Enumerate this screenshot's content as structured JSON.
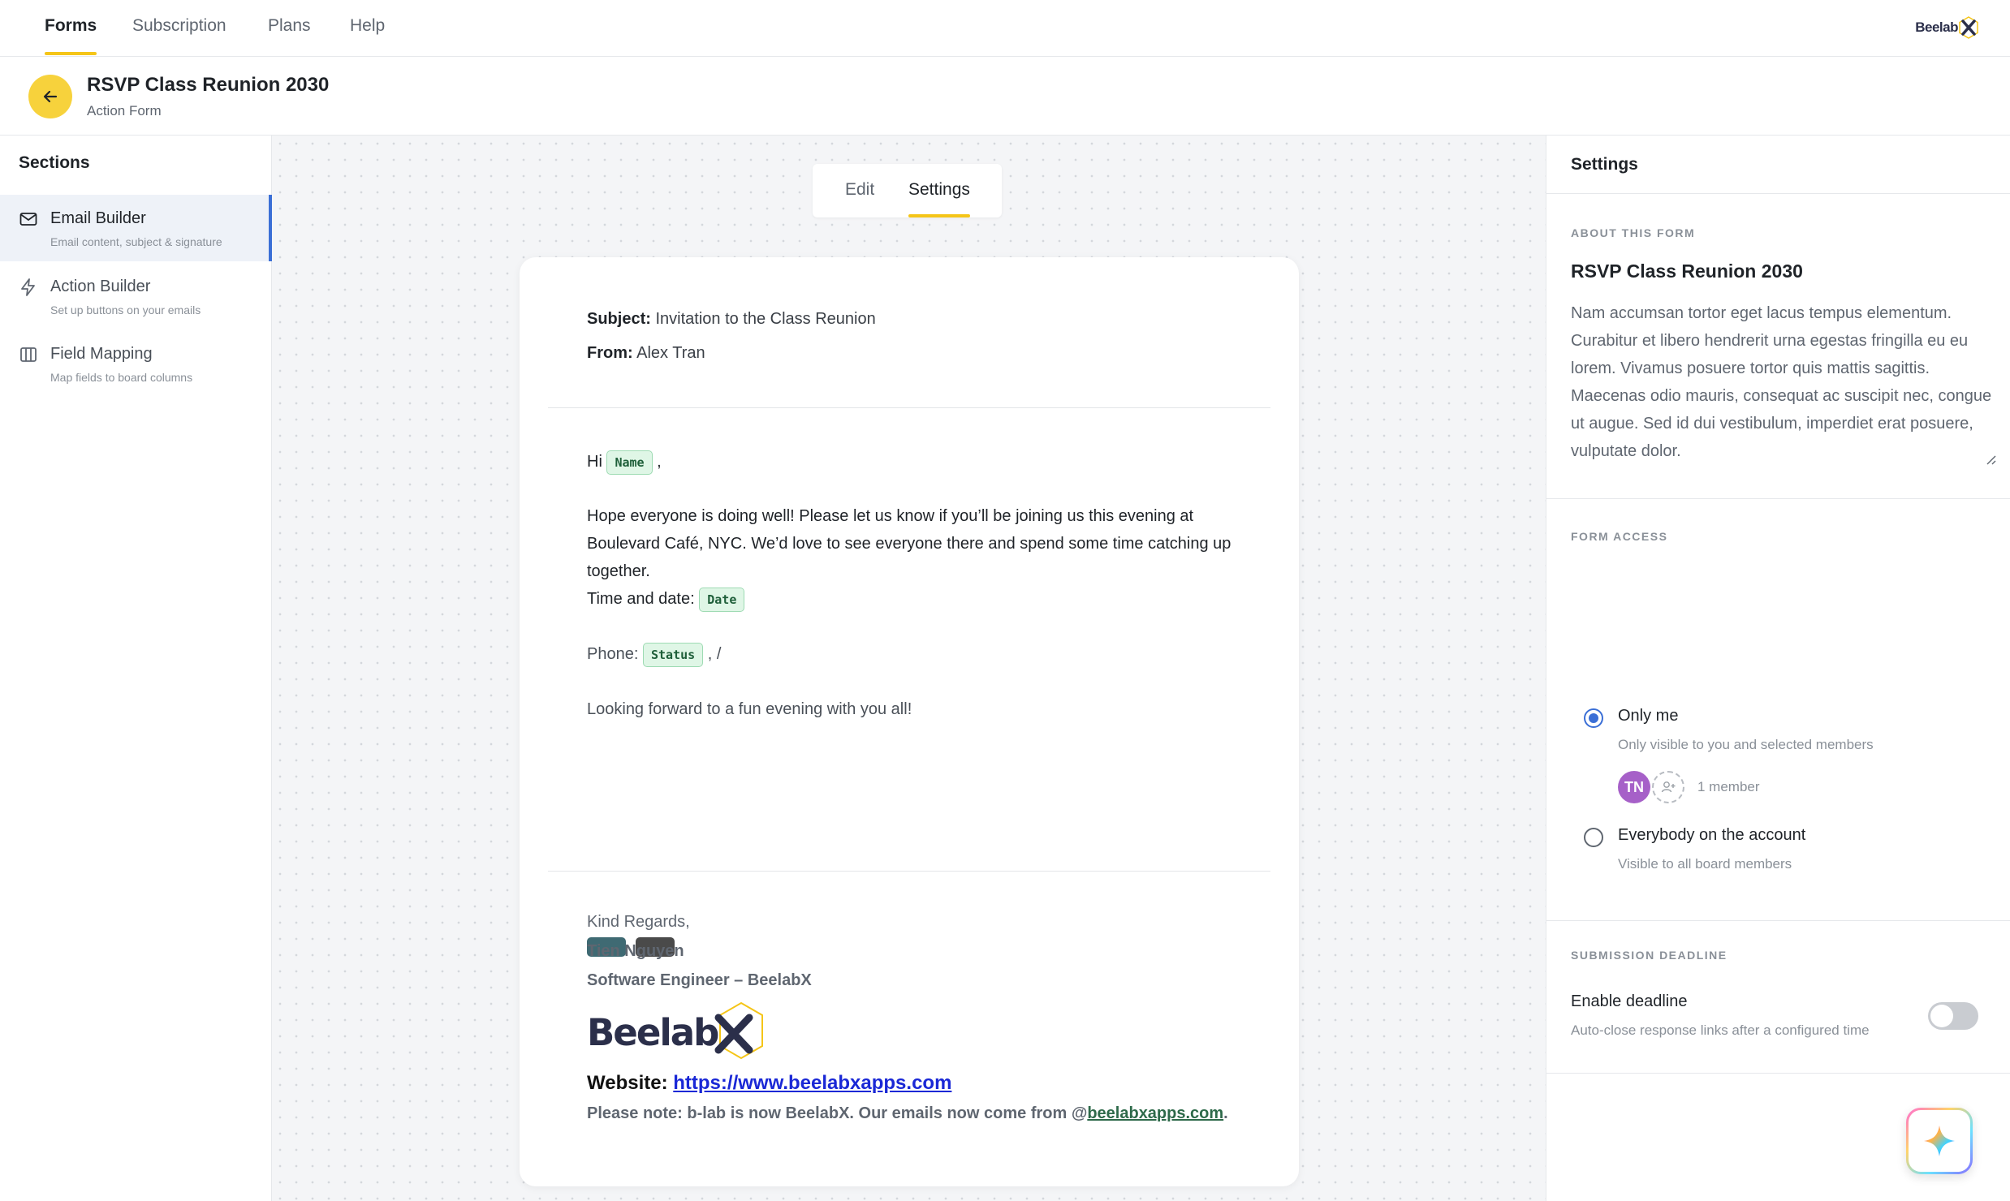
{
  "topnav": {
    "tabs": [
      {
        "label": "Forms",
        "active": true
      },
      {
        "label": "Subscription",
        "active": false
      },
      {
        "label": "Plans",
        "active": false
      },
      {
        "label": "Help",
        "active": false
      }
    ],
    "brand": "Beelab"
  },
  "header": {
    "title": "RSVP Class Reunion 2030",
    "subtitle": "Action Form",
    "back_icon": "arrow-left-icon"
  },
  "sidebar": {
    "heading": "Sections",
    "items": [
      {
        "label": "Email Builder",
        "desc": "Email content, subject & signature",
        "icon": "mail-icon",
        "active": true
      },
      {
        "label": "Action Builder",
        "desc": "Set up buttons on your emails",
        "icon": "bolt-icon",
        "active": false
      },
      {
        "label": "Field Mapping",
        "desc": "Map fields to board columns",
        "icon": "columns-icon",
        "active": false
      }
    ]
  },
  "editor_tabs": {
    "edit": "Edit",
    "settings": "Settings",
    "active": "Settings"
  },
  "email": {
    "subject_label": "Subject:",
    "subject": "Invitation to the Class Reunion",
    "from_label": "From:",
    "from": "Alex Tran",
    "greeting": "Hi",
    "name_tag": "Name",
    "greeting_suffix": ",",
    "paragraph": "Hope everyone is doing well! Please let us know if you’ll be joining us this evening at Boulevard Café, NYC. We’d love to see everyone there and spend some time catching up together.",
    "time_label": "Time and date:",
    "date_tag": "Date",
    "phone_label": "Phone:",
    "status_tag": "Status",
    "phone_suffix": ", /",
    "closing": "Looking forward to a fun evening with you all!",
    "button_colors": [
      "#3f6a73",
      "#4a4a4a"
    ],
    "signature": {
      "regards": "Kind Regards,",
      "name": "Tien Nguyen",
      "role": "Software Engineer – BeelabX",
      "logo_text": "Beelab",
      "website_label": "Website:",
      "website_url": "https://www.beelabxapps.com",
      "note_prefix": "Please note: b-lab is now BeelabX. Our emails now come from @",
      "note_domain": "beelabxapps.com",
      "note_suffix": "."
    }
  },
  "settings": {
    "heading": "Settings",
    "about": {
      "caption": "ABOUT THIS FORM",
      "name": "RSVP Class Reunion 2030",
      "description": "Nam accumsan tortor eget lacus tempus elementum. Curabitur et libero hendrerit urna egestas fringilla eu eu lorem. Vivamus posuere tortor quis mattis sagittis. Maecenas odio mauris, consequat ac suscipit nec, congue ut augue. Sed id dui vestibulum, imperdiet erat posuere, vulputate dolor."
    },
    "access": {
      "caption": "FORM ACCESS",
      "options": [
        {
          "label": "Only me",
          "desc": "Only visible to you and selected members",
          "selected": true
        },
        {
          "label": "Everybody on the account",
          "desc": "Visible to all board members",
          "selected": false
        }
      ],
      "avatar_initials": "TN",
      "member_count": "1 member"
    },
    "deadline": {
      "caption": "SUBMISSION DEADLINE",
      "label": "Enable deadline",
      "desc": "Auto-close response links after a configured time",
      "enabled": false
    }
  },
  "colors": {
    "accent_yellow": "#f5c518",
    "active_blue": "#3b6fd6",
    "tag_green": "#dff6e6"
  }
}
